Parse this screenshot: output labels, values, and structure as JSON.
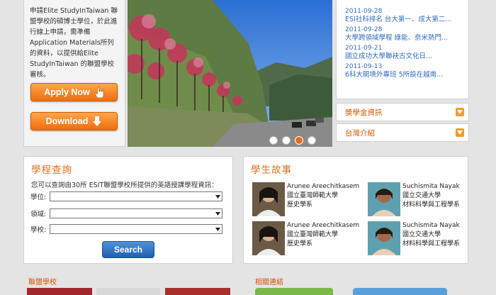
{
  "intro": {
    "text": "申請Elite StudyInTaiwan 聯盟學校的碩博士學位，於此進行線上申請，需準備Application Materials所列的資料，以提供給Elite StudyInTaiwan 的聯盟學校審核。",
    "apply_label": "Apply Now",
    "download_label": "Download"
  },
  "hero": {
    "slides": 4,
    "active_slide": 3
  },
  "news": {
    "items": [
      {
        "date": "2011-09-28",
        "title": "ESI社科排名 台大第一、成大第二..."
      },
      {
        "date": "2011-09-28",
        "title": "大學跨領域學程 綠能、奈米熱門..."
      },
      {
        "date": "2011-09-21",
        "title": "國立成功大學聯袂古文化日..."
      },
      {
        "date": "2011-09-13",
        "title": "6科大開境外專班 5所設在越南..."
      }
    ]
  },
  "accordion": {
    "scholarship": "獎學金資訊",
    "taiwan": "台灣介紹"
  },
  "search": {
    "title": "學程查詢",
    "desc": "您可以查詢由30所 ESIT聯盟學校所提供的英語授課學程資訊：",
    "fields": [
      {
        "label": "學位:"
      },
      {
        "label": "領域:"
      },
      {
        "label": "學校:"
      }
    ],
    "button": "Search"
  },
  "stories": {
    "title": "學生故事",
    "items": [
      {
        "name": "Arunee Areechitkasem",
        "school": "國立臺灣師範大學",
        "dept": "歷史學系"
      },
      {
        "name": "Suchismita Nayak",
        "school": "國立交通大學",
        "dept": "材料科學與工程學系"
      },
      {
        "name": "Arunee Areechitkasem",
        "school": "國立臺灣師範大學",
        "dept": "歷史學系"
      },
      {
        "name": "Suchismita Nayak",
        "school": "國立交通大學",
        "dept": "材料科學與工程學系"
      }
    ]
  },
  "bottom": {
    "partners_title": "聯盟學校",
    "links_title": "相關連結"
  },
  "colors": {
    "accent_orange": "#e07020",
    "link_blue": "#2f6dc0",
    "search_blue": "#1f5fb0"
  }
}
